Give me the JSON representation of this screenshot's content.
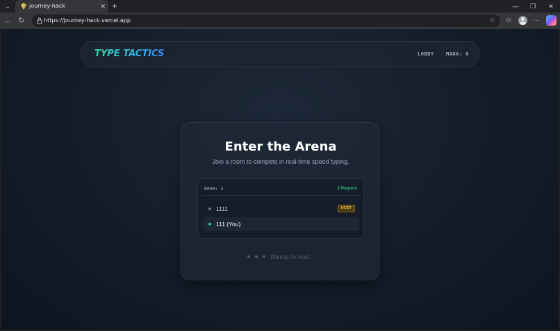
{
  "browser": {
    "tab_title": "journey-hack",
    "url": "https://journey-hack.vercel.app"
  },
  "app": {
    "logo": "TYPE TACTICS",
    "nav": {
      "lobby": "LOBBY",
      "mana": "MANA: 0"
    }
  },
  "card": {
    "title": "Enter the Arena",
    "subtitle": "Join a room to compete in real-time speed typing.",
    "room": {
      "label": "ROOM: 2",
      "count": "2 Players",
      "players": [
        {
          "name": "1111",
          "badge": "HOST",
          "status_color": "#6b7687"
        },
        {
          "name": "111 (You)",
          "badge": "",
          "status_color": "#2ec27e"
        }
      ]
    },
    "waiting": "Waiting for host..."
  },
  "colors": {
    "accent_green": "#2ec27e",
    "host_badge": "#e8b94a"
  }
}
